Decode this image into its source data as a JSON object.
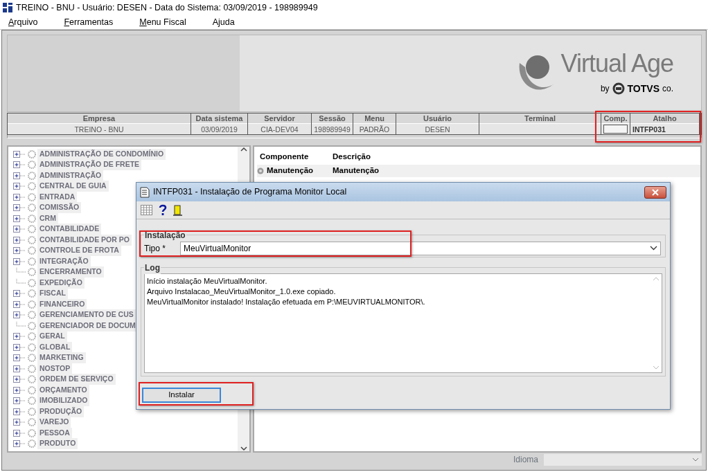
{
  "window": {
    "title": "TREINO - BNU - Usuário: DESEN - Data do Sistema: 03/09/2019 - 198989949"
  },
  "menu": [
    {
      "label": "Arquivo",
      "underlined_first": true
    },
    {
      "label": "Ferramentas",
      "underlined_first": true
    },
    {
      "label": "Menu Fiscal",
      "underlined_first": true
    },
    {
      "label": "Ajuda",
      "underlined_first": false
    }
  ],
  "banner": {
    "logo_text": "Virtual Age",
    "byline": "by",
    "brand": "TOTVS",
    "brand_suffix": "co."
  },
  "session": {
    "columns": [
      {
        "label": "Empresa",
        "value": "TREINO - BNU",
        "kind": "text",
        "highlighted": false
      },
      {
        "label": "Data sistema",
        "value": "03/09/2019",
        "kind": "text",
        "highlighted": false
      },
      {
        "label": "Servidor",
        "value": "CIA-DEV04",
        "kind": "text",
        "highlighted": false
      },
      {
        "label": "Sessão",
        "value": "198989949",
        "kind": "text",
        "highlighted": false
      },
      {
        "label": "Menu",
        "value": "PADRÃO",
        "kind": "text",
        "highlighted": false
      },
      {
        "label": "Usuário",
        "value": "DESEN",
        "kind": "text",
        "highlighted": false
      },
      {
        "label": "Terminal",
        "kind": "text",
        "highlighted": false
      },
      {
        "label": "Comp.",
        "kind": "toggle",
        "highlighted": true
      },
      {
        "label": "Atalho",
        "value": "INTFP031",
        "kind": "bold",
        "highlighted": true
      }
    ]
  },
  "tree": {
    "items": [
      {
        "label": "ADMINISTRAÇÃO DE CONDOMÍNIO",
        "expandable": true
      },
      {
        "label": "ADMINISTRAÇÃO DE FRETE",
        "expandable": true
      },
      {
        "label": "ADMINISTRAÇÃO",
        "expandable": true
      },
      {
        "label": "CENTRAL DE GUIA",
        "expandable": true
      },
      {
        "label": "ENTRADA",
        "expandable": true
      },
      {
        "label": "COMISSÃO",
        "expandable": true
      },
      {
        "label": "CRM",
        "expandable": true
      },
      {
        "label": "CONTABILIDADE",
        "expandable": true
      },
      {
        "label": "CONTABILIDADE POR PO",
        "expandable": true
      },
      {
        "label": "CONTROLE DE FROTA",
        "expandable": true
      },
      {
        "label": "INTEGRAÇÃO",
        "expandable": true
      },
      {
        "label": "ENCERRAMENTO",
        "expandable": false
      },
      {
        "label": "EXPEDIÇÃO",
        "expandable": false
      },
      {
        "label": "FISCAL",
        "expandable": true
      },
      {
        "label": "FINANCEIRO",
        "expandable": true
      },
      {
        "label": "GERENCIAMENTO DE CUS",
        "expandable": true
      },
      {
        "label": "GERENCIADOR DE DOCUM",
        "expandable": false
      },
      {
        "label": "GERAL",
        "expandable": true
      },
      {
        "label": "GLOBAL",
        "expandable": true
      },
      {
        "label": "MARKETING",
        "expandable": true
      },
      {
        "label": "NOSTOP",
        "expandable": true
      },
      {
        "label": "ORDEM DE SERVIÇO",
        "expandable": true
      },
      {
        "label": "ORÇAMENTO",
        "expandable": true
      },
      {
        "label": "IMOBILIZADO",
        "expandable": true
      },
      {
        "label": "PRODUÇÃO",
        "expandable": true
      },
      {
        "label": "VAREJO",
        "expandable": true
      },
      {
        "label": "PESSOA",
        "expandable": true
      },
      {
        "label": "PRODUTO",
        "expandable": true
      }
    ]
  },
  "components": {
    "columns": [
      "Componente",
      "Descrição"
    ],
    "rows": [
      {
        "componente": "Manutenção",
        "descricao": "Manutenção"
      }
    ]
  },
  "dialog": {
    "title": "INTFP031 - Instalação de Programa Monitor Local",
    "install_group": {
      "legend": "Instalação",
      "highlighted": true,
      "field_label": "Tipo *",
      "value": "MeuVirtualMonitor"
    },
    "log_group": {
      "legend": "Log",
      "lines": [
        "Início instalação MeuVirtualMonitor.",
        "Arquivo Instalacao_MeuVirtualMonitor_1.0.exe copiado.",
        "MeuVirtualMonitor instalado! Instalação efetuada em P:\\MEUVIRTUALMONITOR\\."
      ]
    },
    "button": {
      "label": "Instalar",
      "focused": true,
      "highlighted": true
    }
  },
  "status_bar": {
    "label": "Idioma"
  }
}
